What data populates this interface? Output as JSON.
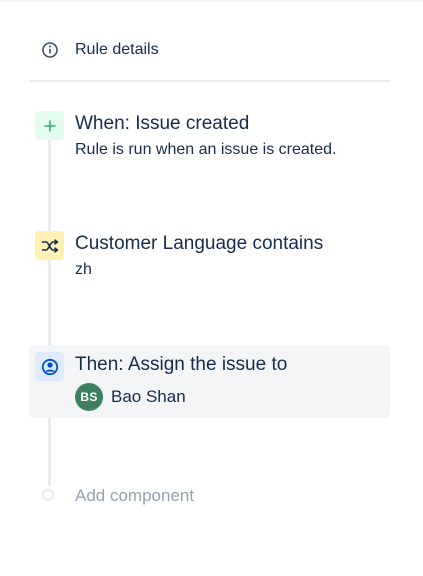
{
  "header": {
    "rule_details_label": "Rule details",
    "rule_details_icon": "info-icon"
  },
  "steps": [
    {
      "kind": "trigger",
      "icon": "plus-icon",
      "title": "When: Issue created",
      "subtitle": "Rule is run when an issue is created."
    },
    {
      "kind": "condition",
      "icon": "shuffle-icon",
      "title": "Customer Language contains",
      "subtitle": "zh"
    },
    {
      "kind": "action",
      "icon": "user-avatar-icon",
      "title": "Then: Assign the issue to",
      "assignee": {
        "initials": "BS",
        "name": "Bao Shan",
        "avatar_color": "#3c8060"
      }
    }
  ],
  "footer": {
    "add_component_label": "Add component"
  },
  "colors": {
    "trigger_badge": "#e3fcef",
    "trigger_icon": "#36b37e",
    "condition_badge": "#fff0b3",
    "condition_icon": "#172b4d",
    "action_badge": "#deebff",
    "action_icon": "#0052cc",
    "text": "#172b4d",
    "muted": "#97a0af"
  }
}
